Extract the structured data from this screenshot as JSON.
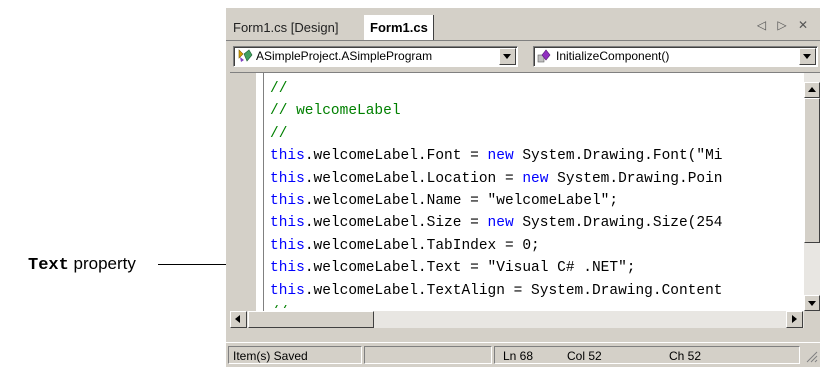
{
  "annotation": {
    "code_word": "Text",
    "rest": " property"
  },
  "tabs": {
    "design": "Form1.cs [Design]",
    "code": "Form1.cs",
    "nav": "◁ ▷ ✕"
  },
  "dropdowns": {
    "class_selector": "ASimpleProject.ASimpleProgram",
    "member_selector": "InitializeComponent()"
  },
  "code_lines": [
    {
      "kind": "comment",
      "text": "//"
    },
    {
      "kind": "comment",
      "text": "// welcomeLabel"
    },
    {
      "kind": "comment",
      "text": "//"
    },
    {
      "kind": "stmt",
      "kw": "this",
      "rest": ".welcomeLabel.Font = ",
      "kw2": "new",
      "rest2": " System.Drawing.Font(\"Mi"
    },
    {
      "kind": "stmt",
      "kw": "this",
      "rest": ".welcomeLabel.Location = ",
      "kw2": "new",
      "rest2": " System.Drawing.Poin"
    },
    {
      "kind": "stmt",
      "kw": "this",
      "rest": ".welcomeLabel.Name = \"welcomeLabel\";",
      "kw2": "",
      "rest2": ""
    },
    {
      "kind": "stmt",
      "kw": "this",
      "rest": ".welcomeLabel.Size = ",
      "kw2": "new",
      "rest2": " System.Drawing.Size(254"
    },
    {
      "kind": "stmt",
      "kw": "this",
      "rest": ".welcomeLabel.TabIndex = 0;",
      "kw2": "",
      "rest2": ""
    },
    {
      "kind": "stmt",
      "kw": "this",
      "rest": ".welcomeLabel.Text = \"Visual C# .NET\";",
      "kw2": "",
      "rest2": ""
    },
    {
      "kind": "stmt",
      "kw": "this",
      "rest": ".welcomeLabel.TextAlign = System.Drawing.Content",
      "kw2": "",
      "rest2": ""
    },
    {
      "kind": "comment",
      "text": "//"
    }
  ],
  "statusbar": {
    "status": "Item(s) Saved",
    "ln": "Ln 68",
    "col": "Col 52",
    "ch": "Ch 52"
  },
  "colors": {
    "keyword": "#0000ff",
    "comment": "#008000",
    "chrome": "#d4d0c8"
  }
}
